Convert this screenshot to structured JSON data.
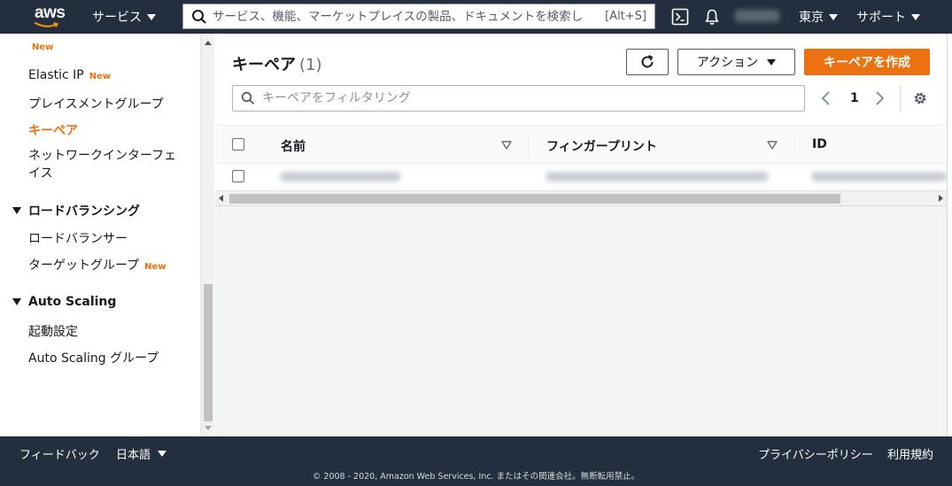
{
  "nav": {
    "logo_text": "aws",
    "services_label": "サービス",
    "search_placeholder": "サービス、機能、マーケットプレイスの製品、ドキュメントを検索し",
    "search_shortcut": "[Alt+S]",
    "region_label": "東京",
    "support_label": "サポート"
  },
  "sidebar": {
    "top_badge": "New",
    "items": [
      {
        "label": "Elastic IP",
        "badge": "New"
      },
      {
        "label": "プレイスメントグループ"
      },
      {
        "label": "キーペア",
        "active": true
      },
      {
        "label": "ネットワークインターフェイス"
      }
    ],
    "sections": [
      {
        "label": "ロードバランシング",
        "items": [
          {
            "label": "ロードバランサー"
          },
          {
            "label": "ターゲットグループ",
            "badge": "New"
          }
        ]
      },
      {
        "label": "Auto Scaling",
        "items": [
          {
            "label": "起動設定"
          },
          {
            "label": "Auto Scaling グループ"
          }
        ]
      }
    ]
  },
  "main": {
    "title": "キーペア",
    "count": "(1)",
    "action_label": "アクション",
    "create_label": "キーペアを作成",
    "filter_placeholder": "キーペアをフィルタリング",
    "page_number": "1",
    "columns": [
      "名前",
      "フィンガープリント",
      "ID"
    ]
  },
  "footer": {
    "feedback": "フィードバック",
    "language": "日本語",
    "privacy": "プライバシーポリシー",
    "terms": "利用規約",
    "copyright": "© 2008 - 2020, Amazon Web Services, Inc. またはその関連会社。無断転用禁止。"
  },
  "colors": {
    "nav_bg": "#232f3e",
    "accent": "#ec7211",
    "text": "#16191f"
  }
}
